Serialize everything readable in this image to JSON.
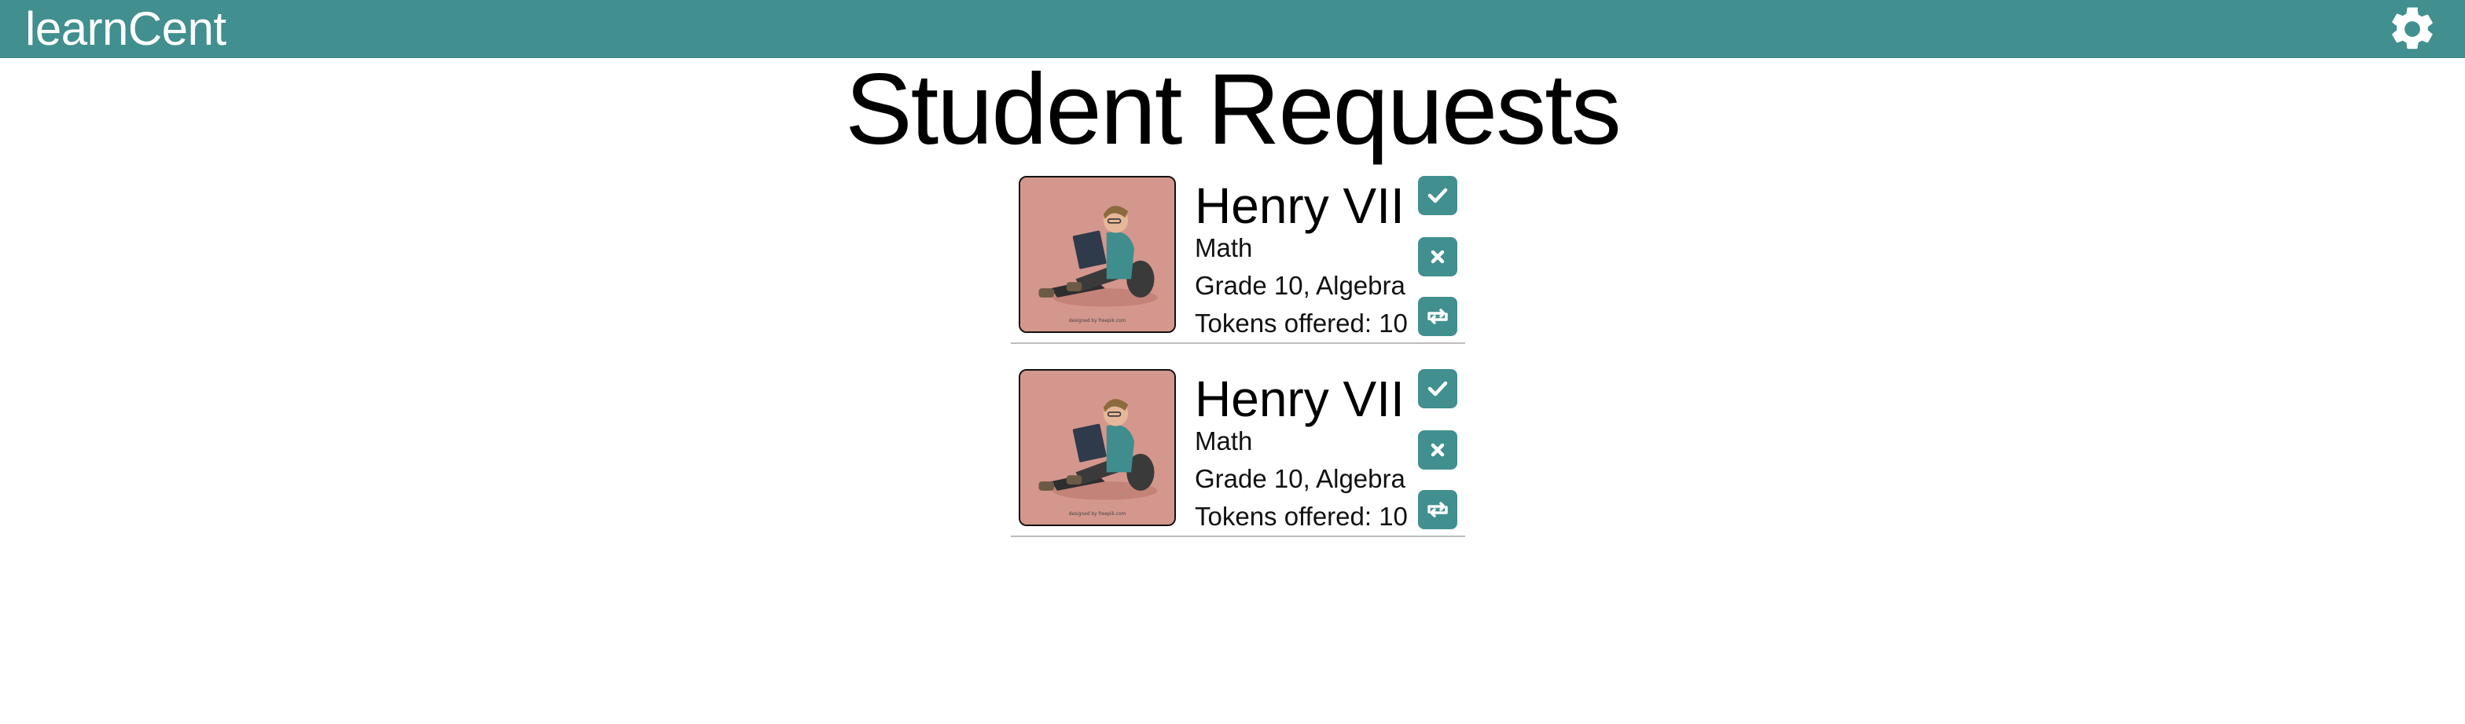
{
  "app": {
    "brand": "learnCent"
  },
  "colors": {
    "accent": "#418f8f",
    "avatar_bg": "#d4978d",
    "divider": "#bdbdbd"
  },
  "icons": {
    "settings": "gear-icon",
    "accept": "check-icon",
    "reject": "close-icon",
    "counter": "retweet-icon"
  },
  "page": {
    "title": "Student Requests"
  },
  "requests": [
    {
      "name": "Henry VII",
      "subject": "Math",
      "grade_topic": "Grade 10, Algebra",
      "tokens": "Tokens offered: 10"
    },
    {
      "name": "Henry VII",
      "subject": "Math",
      "grade_topic": "Grade 10, Algebra",
      "tokens": "Tokens offered: 10"
    }
  ]
}
